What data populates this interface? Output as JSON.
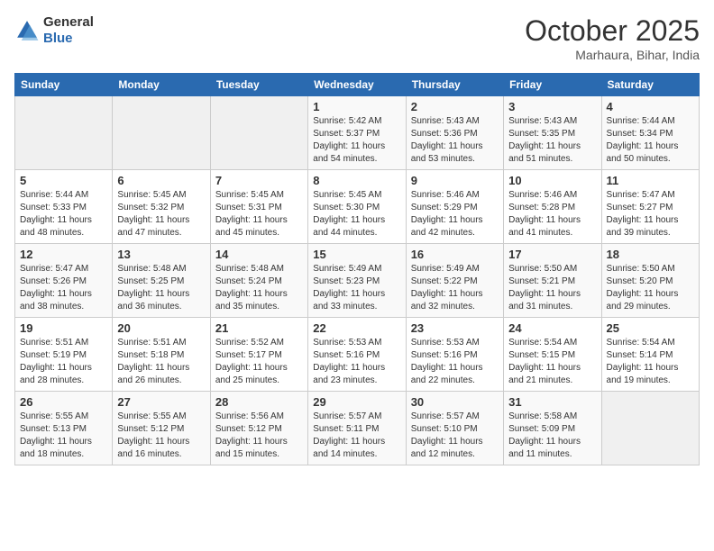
{
  "header": {
    "logo_general": "General",
    "logo_blue": "Blue",
    "month_title": "October 2025",
    "location": "Marhaura, Bihar, India"
  },
  "days_of_week": [
    "Sunday",
    "Monday",
    "Tuesday",
    "Wednesday",
    "Thursday",
    "Friday",
    "Saturday"
  ],
  "weeks": [
    [
      {
        "num": "",
        "info": ""
      },
      {
        "num": "",
        "info": ""
      },
      {
        "num": "",
        "info": ""
      },
      {
        "num": "1",
        "info": "Sunrise: 5:42 AM\nSunset: 5:37 PM\nDaylight: 11 hours\nand 54 minutes."
      },
      {
        "num": "2",
        "info": "Sunrise: 5:43 AM\nSunset: 5:36 PM\nDaylight: 11 hours\nand 53 minutes."
      },
      {
        "num": "3",
        "info": "Sunrise: 5:43 AM\nSunset: 5:35 PM\nDaylight: 11 hours\nand 51 minutes."
      },
      {
        "num": "4",
        "info": "Sunrise: 5:44 AM\nSunset: 5:34 PM\nDaylight: 11 hours\nand 50 minutes."
      }
    ],
    [
      {
        "num": "5",
        "info": "Sunrise: 5:44 AM\nSunset: 5:33 PM\nDaylight: 11 hours\nand 48 minutes."
      },
      {
        "num": "6",
        "info": "Sunrise: 5:45 AM\nSunset: 5:32 PM\nDaylight: 11 hours\nand 47 minutes."
      },
      {
        "num": "7",
        "info": "Sunrise: 5:45 AM\nSunset: 5:31 PM\nDaylight: 11 hours\nand 45 minutes."
      },
      {
        "num": "8",
        "info": "Sunrise: 5:45 AM\nSunset: 5:30 PM\nDaylight: 11 hours\nand 44 minutes."
      },
      {
        "num": "9",
        "info": "Sunrise: 5:46 AM\nSunset: 5:29 PM\nDaylight: 11 hours\nand 42 minutes."
      },
      {
        "num": "10",
        "info": "Sunrise: 5:46 AM\nSunset: 5:28 PM\nDaylight: 11 hours\nand 41 minutes."
      },
      {
        "num": "11",
        "info": "Sunrise: 5:47 AM\nSunset: 5:27 PM\nDaylight: 11 hours\nand 39 minutes."
      }
    ],
    [
      {
        "num": "12",
        "info": "Sunrise: 5:47 AM\nSunset: 5:26 PM\nDaylight: 11 hours\nand 38 minutes."
      },
      {
        "num": "13",
        "info": "Sunrise: 5:48 AM\nSunset: 5:25 PM\nDaylight: 11 hours\nand 36 minutes."
      },
      {
        "num": "14",
        "info": "Sunrise: 5:48 AM\nSunset: 5:24 PM\nDaylight: 11 hours\nand 35 minutes."
      },
      {
        "num": "15",
        "info": "Sunrise: 5:49 AM\nSunset: 5:23 PM\nDaylight: 11 hours\nand 33 minutes."
      },
      {
        "num": "16",
        "info": "Sunrise: 5:49 AM\nSunset: 5:22 PM\nDaylight: 11 hours\nand 32 minutes."
      },
      {
        "num": "17",
        "info": "Sunrise: 5:50 AM\nSunset: 5:21 PM\nDaylight: 11 hours\nand 31 minutes."
      },
      {
        "num": "18",
        "info": "Sunrise: 5:50 AM\nSunset: 5:20 PM\nDaylight: 11 hours\nand 29 minutes."
      }
    ],
    [
      {
        "num": "19",
        "info": "Sunrise: 5:51 AM\nSunset: 5:19 PM\nDaylight: 11 hours\nand 28 minutes."
      },
      {
        "num": "20",
        "info": "Sunrise: 5:51 AM\nSunset: 5:18 PM\nDaylight: 11 hours\nand 26 minutes."
      },
      {
        "num": "21",
        "info": "Sunrise: 5:52 AM\nSunset: 5:17 PM\nDaylight: 11 hours\nand 25 minutes."
      },
      {
        "num": "22",
        "info": "Sunrise: 5:53 AM\nSunset: 5:16 PM\nDaylight: 11 hours\nand 23 minutes."
      },
      {
        "num": "23",
        "info": "Sunrise: 5:53 AM\nSunset: 5:16 PM\nDaylight: 11 hours\nand 22 minutes."
      },
      {
        "num": "24",
        "info": "Sunrise: 5:54 AM\nSunset: 5:15 PM\nDaylight: 11 hours\nand 21 minutes."
      },
      {
        "num": "25",
        "info": "Sunrise: 5:54 AM\nSunset: 5:14 PM\nDaylight: 11 hours\nand 19 minutes."
      }
    ],
    [
      {
        "num": "26",
        "info": "Sunrise: 5:55 AM\nSunset: 5:13 PM\nDaylight: 11 hours\nand 18 minutes."
      },
      {
        "num": "27",
        "info": "Sunrise: 5:55 AM\nSunset: 5:12 PM\nDaylight: 11 hours\nand 16 minutes."
      },
      {
        "num": "28",
        "info": "Sunrise: 5:56 AM\nSunset: 5:12 PM\nDaylight: 11 hours\nand 15 minutes."
      },
      {
        "num": "29",
        "info": "Sunrise: 5:57 AM\nSunset: 5:11 PM\nDaylight: 11 hours\nand 14 minutes."
      },
      {
        "num": "30",
        "info": "Sunrise: 5:57 AM\nSunset: 5:10 PM\nDaylight: 11 hours\nand 12 minutes."
      },
      {
        "num": "31",
        "info": "Sunrise: 5:58 AM\nSunset: 5:09 PM\nDaylight: 11 hours\nand 11 minutes."
      },
      {
        "num": "",
        "info": ""
      }
    ]
  ]
}
